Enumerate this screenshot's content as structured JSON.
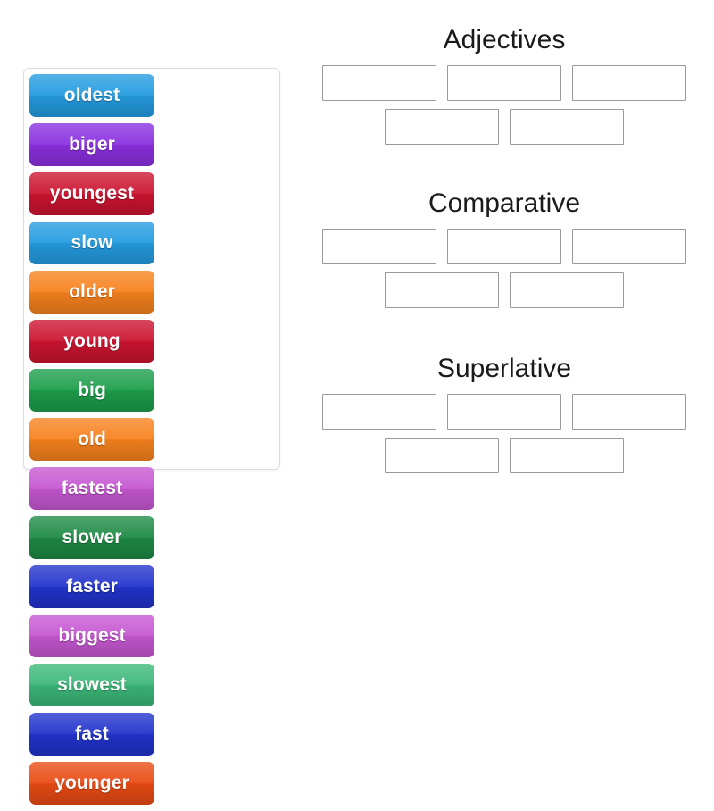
{
  "activity": {
    "type": "group-sort",
    "tile_pool": {
      "name": "word-tile-pool",
      "tiles": [
        {
          "label": "oldest",
          "color": "#249ce0"
        },
        {
          "label": "biger",
          "color": "#8b2fe0"
        },
        {
          "label": "youngest",
          "color": "#cc1430"
        },
        {
          "label": "slow",
          "color": "#249ce0"
        },
        {
          "label": "older",
          "color": "#f7821e"
        },
        {
          "label": "young",
          "color": "#cc1430"
        },
        {
          "label": "big",
          "color": "#1d9e4b"
        },
        {
          "label": "old",
          "color": "#f7821e"
        },
        {
          "label": "fastest",
          "color": "#c657d2"
        },
        {
          "label": "slower",
          "color": "#1d8a44"
        },
        {
          "label": "faster",
          "color": "#2233cc"
        },
        {
          "label": "biggest",
          "color": "#c657d2"
        },
        {
          "label": "slowest",
          "color": "#3cb878"
        },
        {
          "label": "fast",
          "color": "#2233cc"
        },
        {
          "label": "younger",
          "color": "#ea4b14"
        }
      ]
    },
    "categories": [
      {
        "title": "Adjectives",
        "rows": [
          [
            {
              "value": ""
            },
            {
              "value": ""
            },
            {
              "value": ""
            }
          ],
          [
            {
              "value": ""
            },
            {
              "value": ""
            }
          ]
        ]
      },
      {
        "title": "Comparative",
        "rows": [
          [
            {
              "value": ""
            },
            {
              "value": ""
            },
            {
              "value": ""
            }
          ],
          [
            {
              "value": ""
            },
            {
              "value": ""
            }
          ]
        ]
      },
      {
        "title": "Superlative",
        "rows": [
          [
            {
              "value": ""
            },
            {
              "value": ""
            },
            {
              "value": ""
            }
          ],
          [
            {
              "value": ""
            },
            {
              "value": ""
            }
          ]
        ]
      }
    ]
  },
  "colors": {
    "background": "#ffffff",
    "pool_border": "#dddddd",
    "slot_border": "#9a9a9a",
    "title_text": "#1a1a1a",
    "tile_text": "#ffffff"
  }
}
